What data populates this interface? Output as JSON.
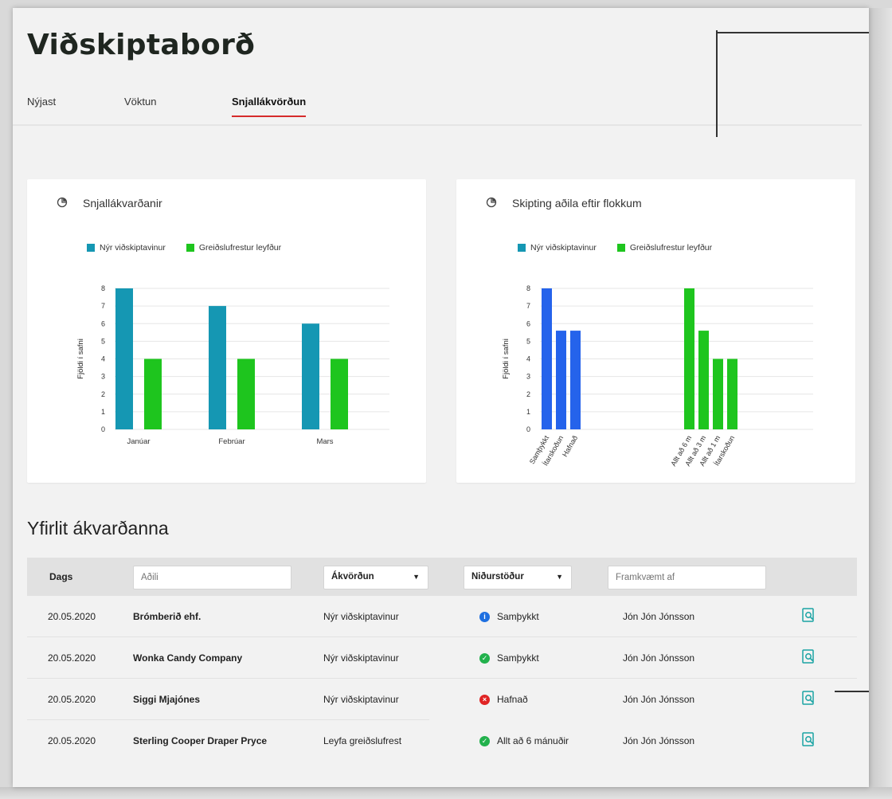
{
  "header": {
    "title": "Viðskiptaborð"
  },
  "tabs": [
    {
      "label": "Nýjast",
      "active": false
    },
    {
      "label": "Vöktun",
      "active": false
    },
    {
      "label": "Snjallákvörðun",
      "active": true
    }
  ],
  "cards": {
    "left": {
      "title": "Snjallákvarðanir",
      "icon": "pie-chart-icon",
      "legend": [
        "Nýr viðskiptavinur",
        "Greiðslufrestur leyfður"
      ]
    },
    "right": {
      "title": "Skipting aðila eftir flokkum",
      "icon": "pie-chart-icon",
      "legend": [
        "Nýr viðskiptavinur",
        "Greiðslufrestur leyfður"
      ]
    }
  },
  "chart_data": [
    {
      "type": "bar",
      "title": "Snjallákvarðanir",
      "categories": [
        "Janúar",
        "Febrúar",
        "Mars"
      ],
      "series": [
        {
          "name": "Nýr viðskiptavinur",
          "values": [
            8,
            7,
            6
          ],
          "color": "#1597b3"
        },
        {
          "name": "Greiðslufrestur leyfður",
          "values": [
            4,
            4,
            4
          ],
          "color": "#1ec51e"
        }
      ],
      "xlabel": "",
      "ylabel": "Fjöldi í safni",
      "ylim": [
        0,
        8
      ],
      "yticks": [
        0,
        1,
        2,
        3,
        4,
        5,
        6,
        7,
        8
      ],
      "grid": true,
      "legend_position": "top"
    },
    {
      "type": "bar",
      "title": "Skipting aðila eftir flokkum",
      "groups": [
        {
          "series": "Nýr viðskiptavinur",
          "color": "#2563eb",
          "categories": [
            "Samþykkt",
            "Ítarskoðun",
            "Hafnað"
          ],
          "values": [
            8,
            5.6,
            5.6
          ]
        },
        {
          "series": "Greiðslufrestur leyfður",
          "color": "#1ec51e",
          "categories": [
            "Allt að 6 m",
            "Allt að 3 m",
            "Allt að 1 m",
            "Ítarskoðun"
          ],
          "values": [
            8,
            5.6,
            4,
            4
          ]
        }
      ],
      "xlabel": "",
      "ylabel": "Fjöldi í safni",
      "ylim": [
        0,
        8
      ],
      "yticks": [
        0,
        1,
        2,
        3,
        4,
        5,
        6,
        7,
        8
      ],
      "grid": true,
      "legend_position": "top"
    }
  ],
  "overview": {
    "title": "Yfirlit ákvarðanna",
    "headers": {
      "date": "Dags",
      "party_placeholder": "Aðili",
      "decision_select": "Ákvörðun",
      "result_select": "Niðurstöður",
      "by_placeholder": "Framkvæmt af"
    },
    "rows": [
      {
        "date": "20.05.2020",
        "party": "Brómberið ehf.",
        "decision": "Nýr viðskiptavinur",
        "result": "Samþykkt",
        "status": "info",
        "by": "Jón Jón Jónsson"
      },
      {
        "date": "20.05.2020",
        "party": "Wonka Candy Company",
        "decision": "Nýr viðskiptavinur",
        "result": "Samþykkt",
        "status": "success",
        "by": "Jón Jón Jónsson"
      },
      {
        "date": "20.05.2020",
        "party": "Siggi Mjajónes",
        "decision": "Nýr viðskiptavinur",
        "result": "Hafnað",
        "status": "error",
        "by": "Jón Jón Jónsson"
      },
      {
        "date": "20.05.2020",
        "party": "Sterling Cooper Draper Pryce",
        "decision": "Leyfa greiðslufrest",
        "result": "Allt að 6 mánuðir",
        "status": "success",
        "by": "Jón Jón Jónsson"
      }
    ]
  },
  "colors": {
    "accent_red": "#d62b2b",
    "teal": "#1597b3",
    "blue": "#2563eb",
    "green": "#1ec51e",
    "status_info": "#1e6fe0",
    "status_success": "#22b14c",
    "status_error": "#e02424",
    "view_icon": "#1aa3a3"
  }
}
